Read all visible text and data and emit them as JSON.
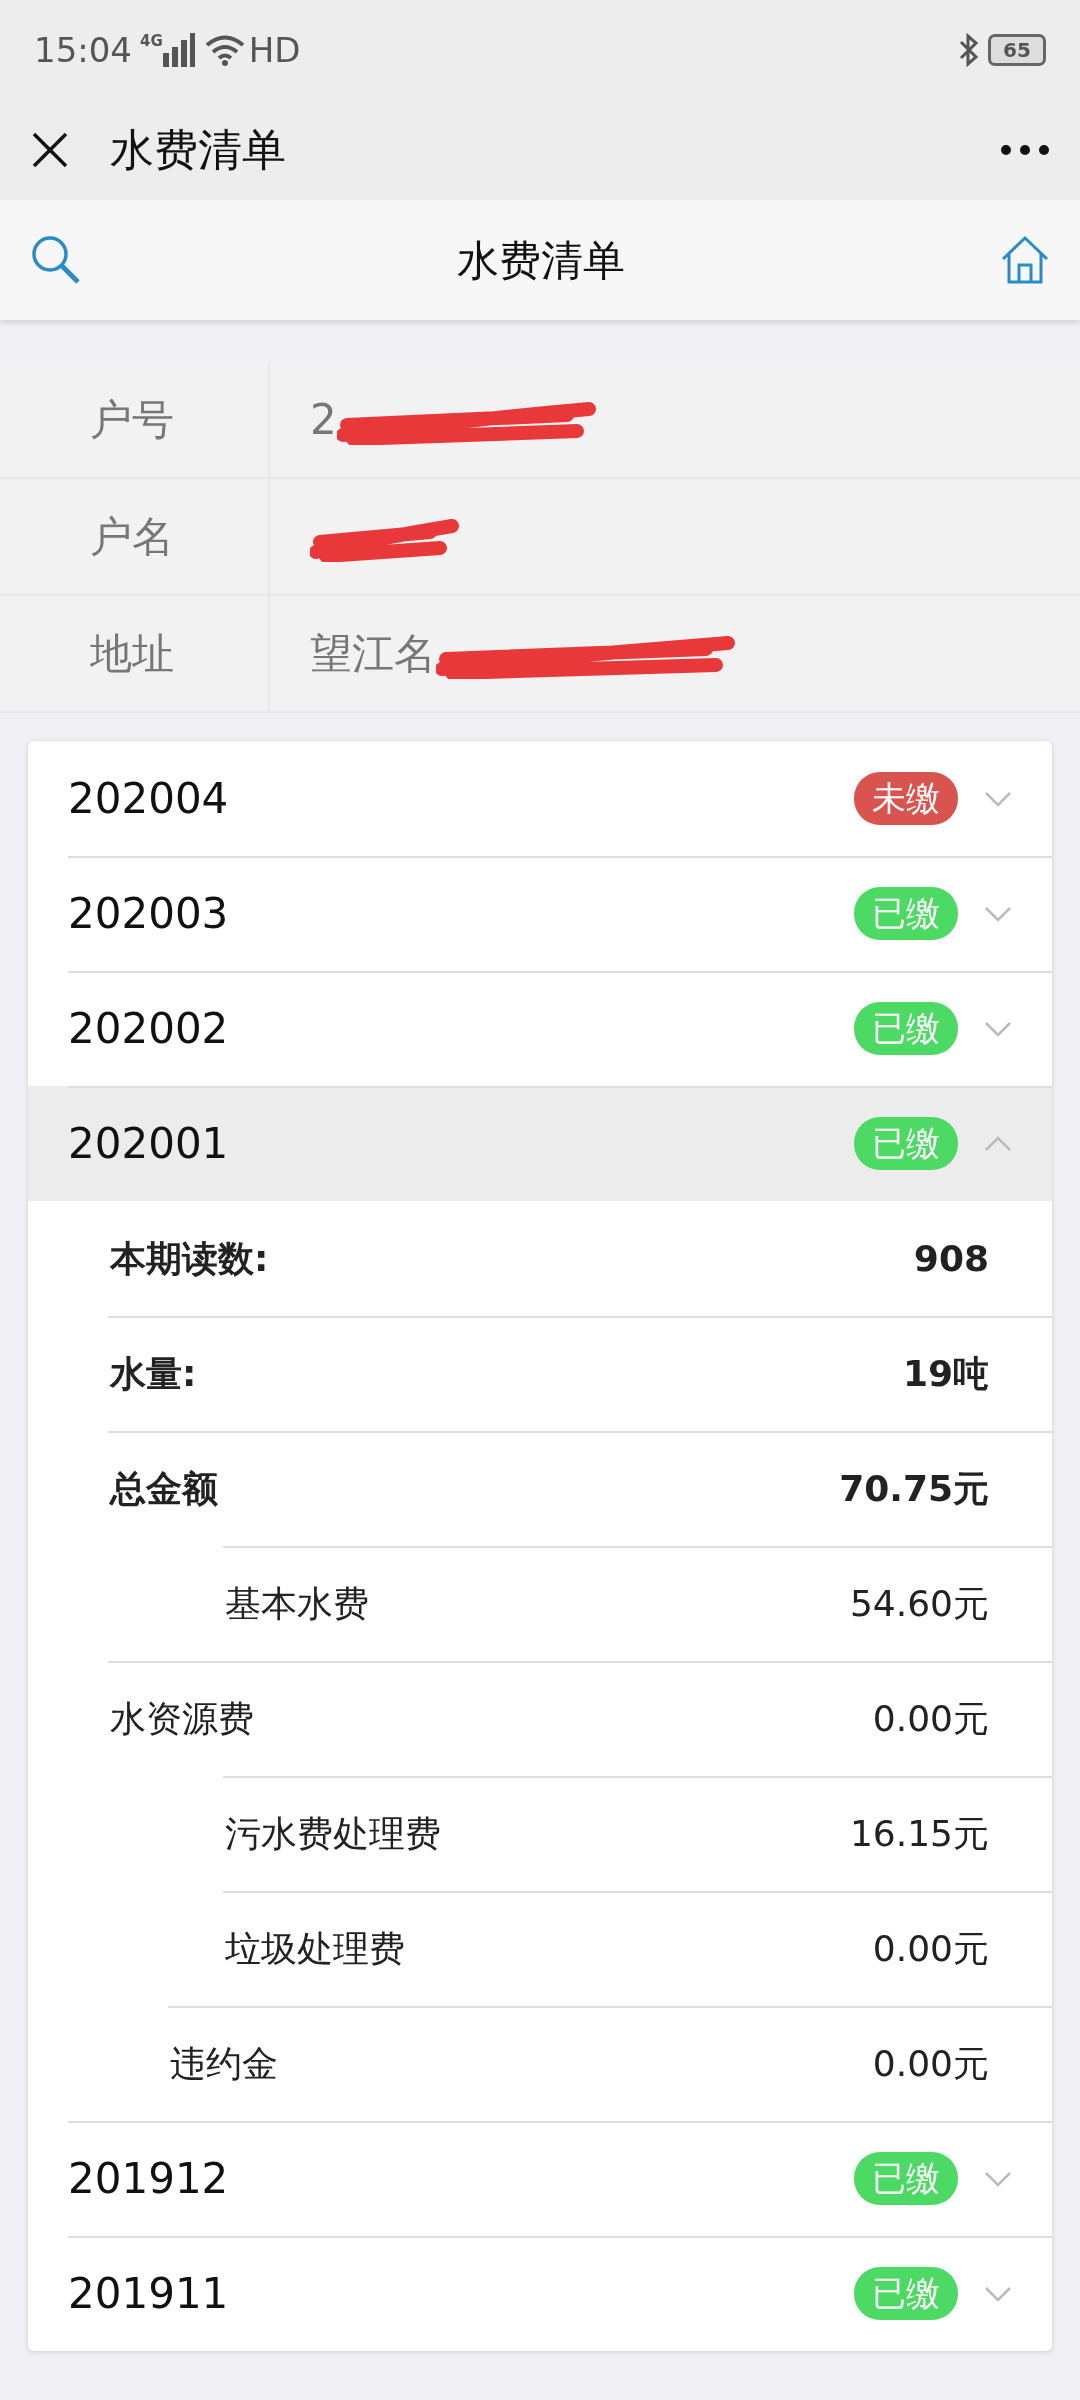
{
  "status_bar": {
    "time": "15:04",
    "network": "4G",
    "hd": "HD",
    "battery": "65"
  },
  "app_bar": {
    "title": "水费清单"
  },
  "page_header": {
    "title": "水费清单"
  },
  "account": [
    {
      "label": "户号",
      "value": "2",
      "redacted": true
    },
    {
      "label": "户名",
      "redacted": true
    },
    {
      "label": "地址",
      "value": "望江名",
      "redacted": true
    }
  ],
  "bills": [
    {
      "period": "202004",
      "status": "未缴",
      "paid": false,
      "expanded": false
    },
    {
      "period": "202003",
      "status": "已缴",
      "paid": true,
      "expanded": false
    },
    {
      "period": "202002",
      "status": "已缴",
      "paid": true,
      "expanded": false
    },
    {
      "period": "202001",
      "status": "已缴",
      "paid": true,
      "expanded": true,
      "details": [
        {
          "kind": "total",
          "label": "本期读数:",
          "value": "908"
        },
        {
          "kind": "total",
          "label": "水量:",
          "value": "19吨"
        },
        {
          "kind": "total",
          "label": "总金额",
          "value": "70.75元"
        },
        {
          "kind": "detail",
          "label": "基本水费",
          "value": "54.60元"
        },
        {
          "kind": "item",
          "label": "水资源费",
          "value": "0.00元"
        },
        {
          "kind": "detail",
          "label": "污水费处理费",
          "value": "16.15元"
        },
        {
          "kind": "detail",
          "label": "垃圾处理费",
          "value": "0.00元"
        },
        {
          "kind": "extra",
          "label": "违约金",
          "value": "0.00元"
        }
      ]
    },
    {
      "period": "201912",
      "status": "已缴",
      "paid": true,
      "expanded": false
    },
    {
      "period": "201911",
      "status": "已缴",
      "paid": true,
      "expanded": false
    }
  ]
}
